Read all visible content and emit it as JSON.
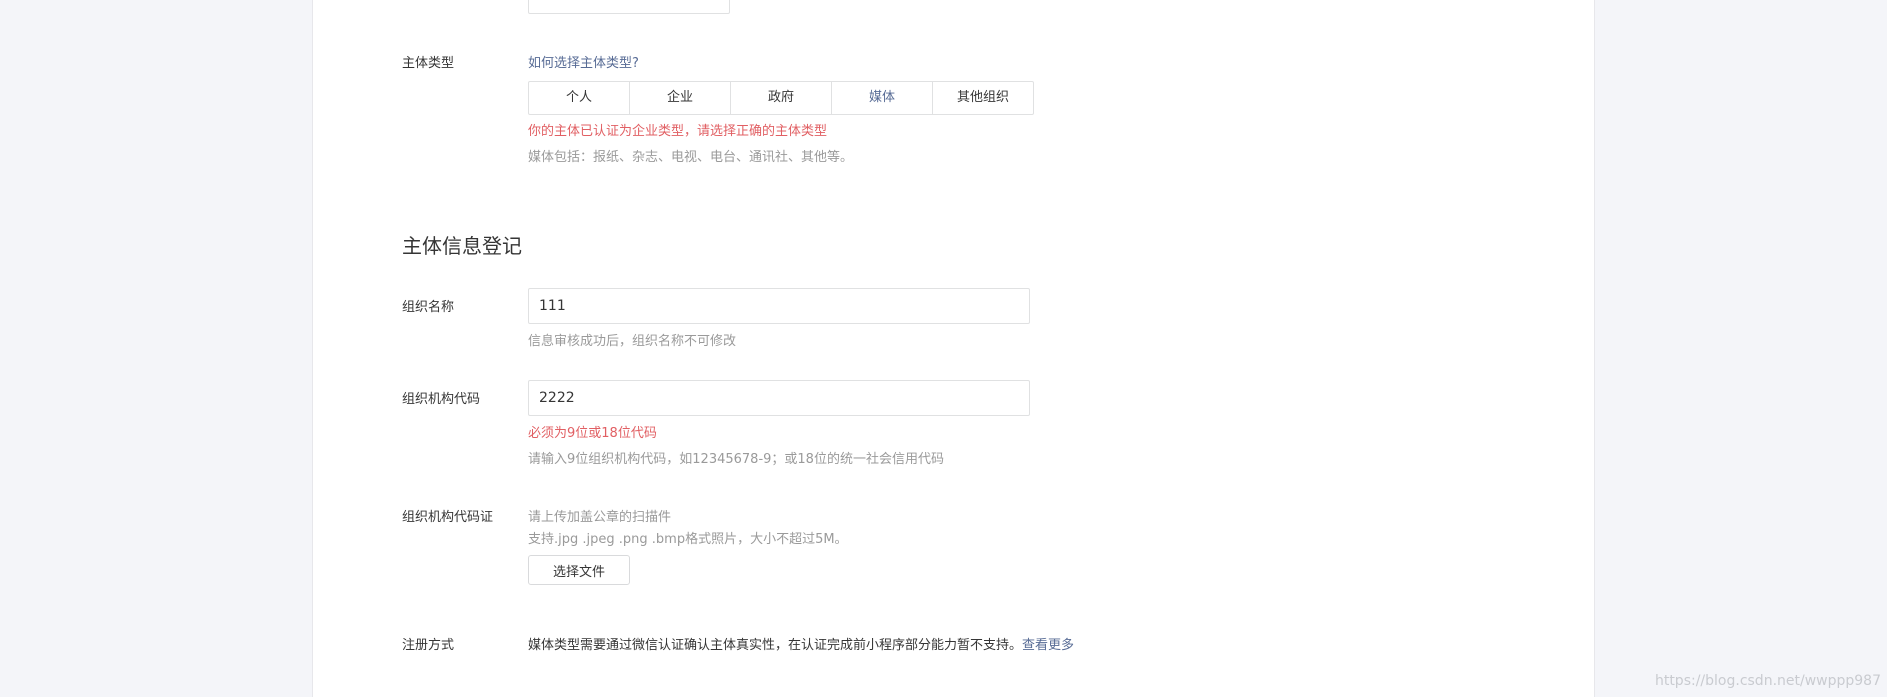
{
  "subject_type": {
    "label": "主体类型",
    "help_link": "如何选择主体类型?",
    "options": [
      "个人",
      "企业",
      "政府",
      "媒体",
      "其他组织"
    ],
    "selected": "媒体",
    "error": "你的主体已认证为企业类型，请选择正确的主体类型",
    "hint": "媒体包括：报纸、杂志、电视、电台、通讯社、其他等。"
  },
  "section": {
    "title": "主体信息登记"
  },
  "org_name": {
    "label": "组织名称",
    "value": "111",
    "hint": "信息审核成功后，组织名称不可修改"
  },
  "org_code": {
    "label": "组织机构代码",
    "value": "2222",
    "error": "必须为9位或18位代码",
    "hint": "请输入9位组织机构代码，如12345678-9；或18位的统一社会信用代码"
  },
  "org_cert": {
    "label": "组织机构代码证",
    "hint1": "请上传加盖公章的扫描件",
    "hint2": "支持.jpg .jpeg .png .bmp格式照片，大小不超过5M。",
    "button": "选择文件"
  },
  "register": {
    "label": "注册方式",
    "text": "媒体类型需要通过微信认证确认主体真实性，在认证完成前小程序部分能力暂不支持。",
    "link": "查看更多"
  },
  "watermark": "https://blog.csdn.net/wwppp987",
  "colors": {
    "link": "#576b95",
    "error": "#e15f63",
    "hint": "#9a9a9a",
    "text": "#353535",
    "background": "#f4f5f9"
  }
}
